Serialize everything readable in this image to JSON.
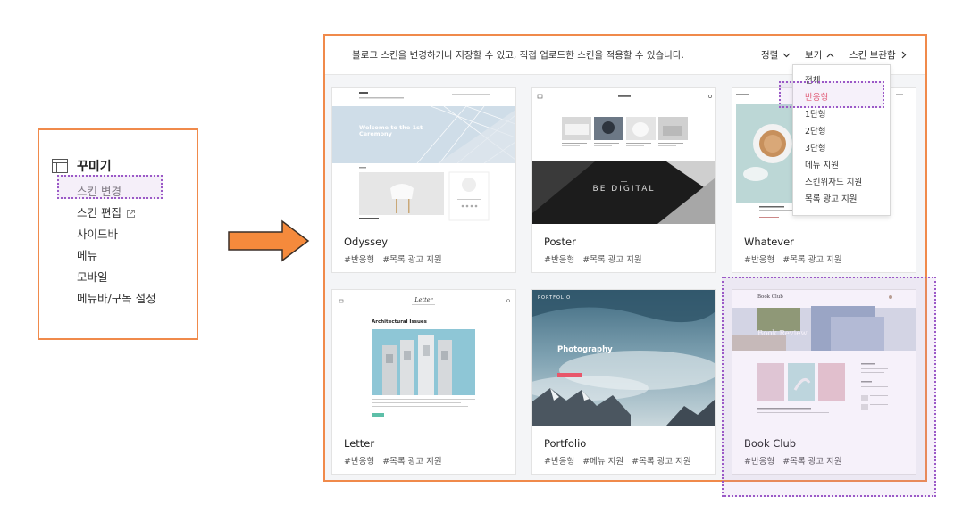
{
  "sidebar": {
    "title": "꾸미기",
    "items": [
      {
        "label": "스킨 변경"
      },
      {
        "label": "스킨 편집"
      },
      {
        "label": "사이드바"
      },
      {
        "label": "메뉴"
      },
      {
        "label": "모바일"
      },
      {
        "label": "메뉴바/구독 설정"
      }
    ]
  },
  "toolbar": {
    "description": "블로그 스킨을 변경하거나 저장할 수 있고, 직접 업로드한 스킨을 적용할 수 있습니다.",
    "sort_label": "정렬",
    "view_label": "보기",
    "storage_label": "스킨 보관함"
  },
  "view_dropdown": {
    "options": [
      "전체",
      "반응형",
      "1단형",
      "2단형",
      "3단형",
      "메뉴 지원",
      "스킨위자드 지원",
      "목록 광고 지원"
    ],
    "selected": "반응형"
  },
  "skins": [
    {
      "name": "Odyssey",
      "tags": [
        "#반응형",
        "#목록 광고 지원"
      ],
      "preview": {
        "title": "Welcome to the 1st Ceremony"
      }
    },
    {
      "name": "Poster",
      "tags": [
        "#반응형",
        "#목록 광고 지원"
      ],
      "preview": {
        "title": "BE DIGITAL"
      }
    },
    {
      "name": "Whatever",
      "tags": [
        "#반응형",
        "#목록 광고 지원"
      ]
    },
    {
      "name": "Letter",
      "tags": [
        "#반응형",
        "#목록 광고 지원"
      ],
      "preview": {
        "logo": "Letter",
        "title": "Architectural Issues"
      }
    },
    {
      "name": "Portfolio",
      "tags": [
        "#반응형",
        "#메뉴 지원",
        "#목록 광고 지원"
      ],
      "preview": {
        "logo": "PORTFOLIO",
        "title": "Photography"
      }
    },
    {
      "name": "Book Club",
      "tags": [
        "#반응형",
        "#목록 광고 지원"
      ],
      "preview": {
        "logo": "Book Club",
        "title": "Book Review"
      }
    }
  ],
  "colors": {
    "accent_orange": "#f08a4b",
    "selection_purple": "#9b59c7",
    "selected_option": "#e8576b"
  }
}
